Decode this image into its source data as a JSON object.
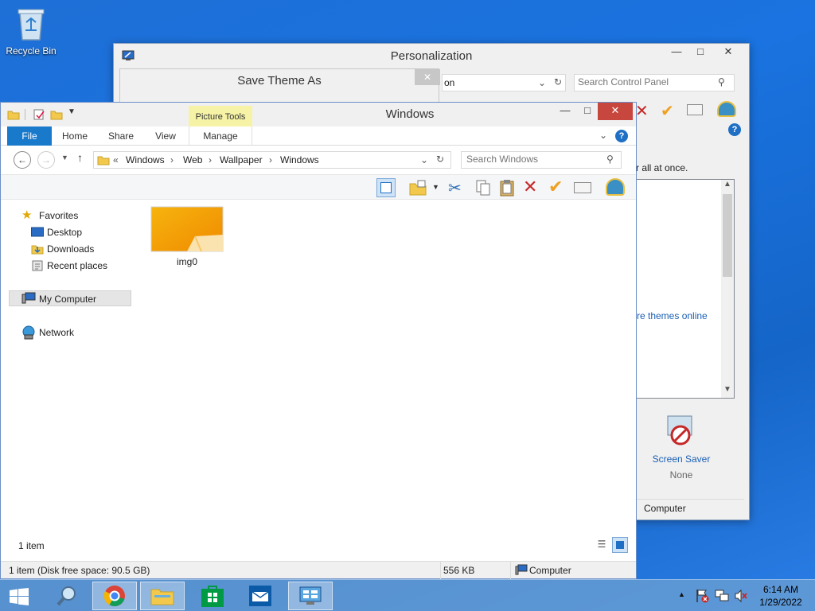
{
  "desktop": {
    "recycle_bin_label": "Recycle Bin"
  },
  "personalization": {
    "title": "Personalization",
    "address_tail": "on",
    "search_placeholder": "Search Control Panel",
    "text_fragment": "r all at once.",
    "link_fragment": "re themes online",
    "screen_saver_label": "Screen Saver",
    "screen_saver_value": "None",
    "status_computer": "Computer"
  },
  "save_dialog": {
    "title": "Save Theme As"
  },
  "explorer": {
    "title": "Windows",
    "picture_tools_label": "Picture Tools",
    "tabs": {
      "file": "File",
      "home": "Home",
      "share": "Share",
      "view": "View",
      "manage": "Manage"
    },
    "breadcrumb": {
      "overflow": "«",
      "items": [
        "Windows",
        "Web",
        "Wallpaper",
        "Windows"
      ]
    },
    "search_placeholder": "Search Windows",
    "nav": {
      "favorites": "Favorites",
      "desktop": "Desktop",
      "downloads": "Downloads",
      "recent": "Recent places",
      "computer": "My Computer",
      "network": "Network"
    },
    "file": {
      "name": "img0"
    },
    "status": {
      "item_count": "1 item",
      "disk_free": "1 item (Disk free space: 90.5 GB)",
      "size": "556 KB",
      "computer": "Computer"
    }
  },
  "taskbar": {
    "time": "6:14 AM",
    "date": "1/29/2022"
  }
}
